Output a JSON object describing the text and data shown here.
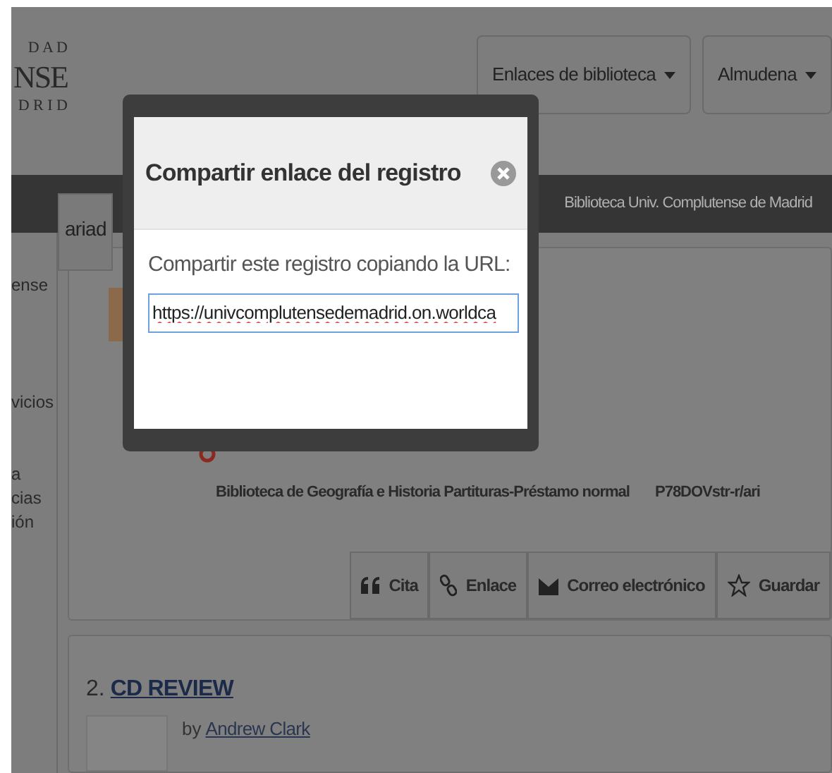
{
  "logo": {
    "line_1": "D A D",
    "line_2": "NSE",
    "line_3": "D R I D"
  },
  "header_buttons": [
    {
      "label": "Enlaces de biblioteca"
    },
    {
      "label": "Almudena"
    }
  ],
  "nav_bar": {
    "library": "Biblioteca Univ. Complutense de Madrid"
  },
  "search_tab": {
    "label": "ariad"
  },
  "sidebar": {
    "items": [
      "ense",
      "vicios",
      "a",
      "cias",
      "ión"
    ]
  },
  "record": {
    "location": "Biblioteca de Geografía e Historia Partituras-Préstamo normal",
    "call_number": "P78DOVstr-r/ari",
    "actions": [
      {
        "kind": "cite",
        "label": "Cita"
      },
      {
        "kind": "link",
        "label": "Enlace"
      },
      {
        "kind": "email",
        "label": "Correo electrónico"
      },
      {
        "kind": "save",
        "label": "Guardar"
      }
    ]
  },
  "result_2": {
    "number": "2.",
    "title": "CD REVIEW",
    "by": "by",
    "author": "Andrew Clark"
  },
  "dialog": {
    "title": "Compartir enlace del registro",
    "prompt": "Compartir este registro copiando la URL:",
    "url": "https://univcomplutensedemadrid.on.worldca"
  }
}
